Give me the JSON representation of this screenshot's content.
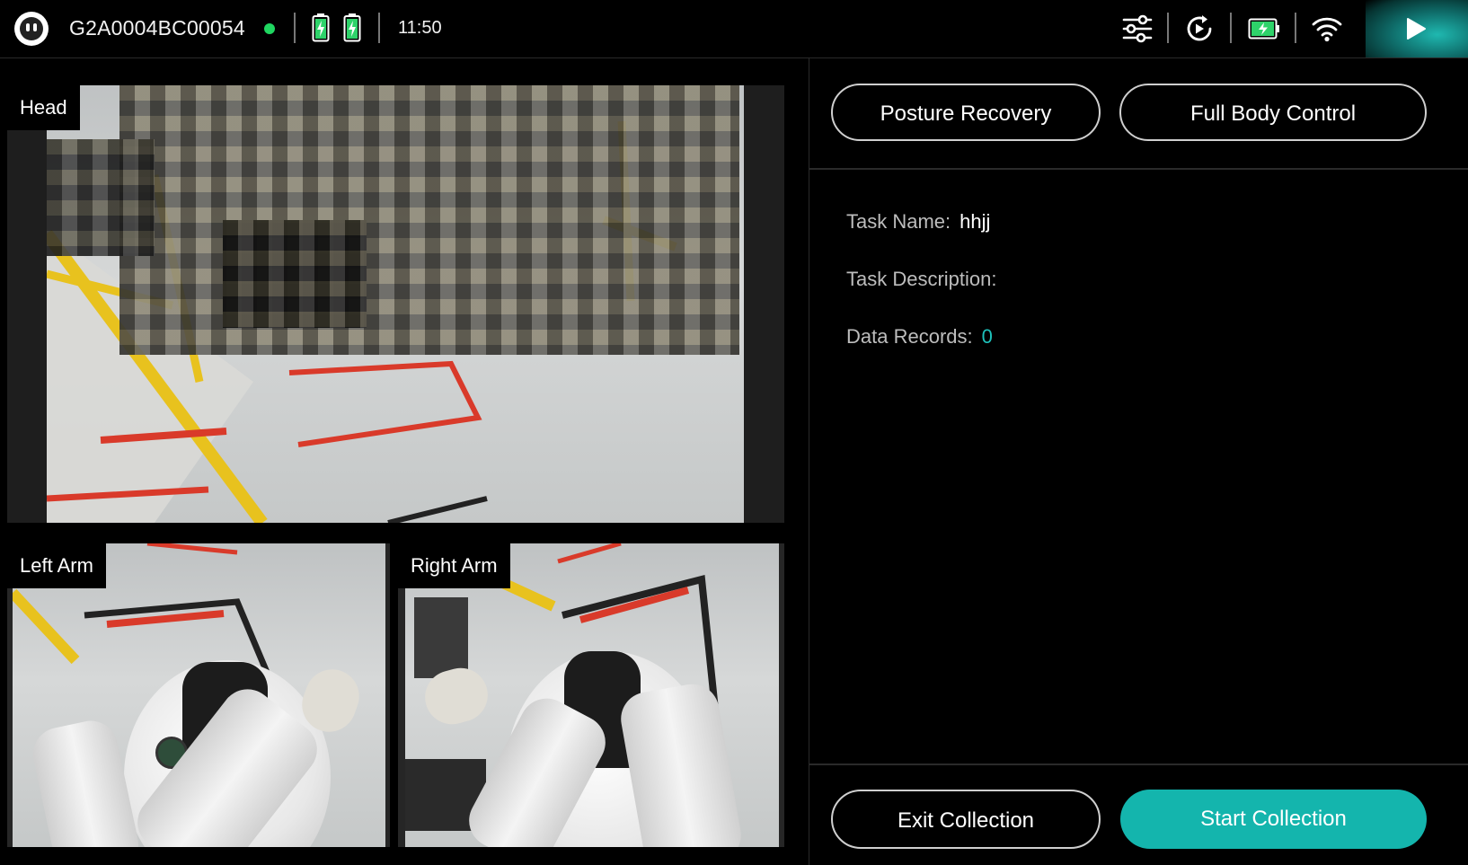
{
  "topbar": {
    "device_id": "G2A0004BC00054",
    "time": "11:50",
    "status_color": "#1fd660",
    "icons": [
      "robot-face-icon",
      "battery-icon",
      "battery-icon",
      "sliders-icon",
      "refresh-play-icon",
      "battery-horizontal-icon",
      "wifi-icon",
      "play-icon"
    ]
  },
  "cameras": {
    "head_label": "Head",
    "left_arm_label": "Left Arm",
    "right_arm_label": "Right Arm"
  },
  "actions": {
    "posture_recovery": "Posture Recovery",
    "full_body_control": "Full Body Control",
    "exit_collection": "Exit Collection",
    "start_collection": "Start Collection"
  },
  "task": {
    "name_label": "Task Name:",
    "name_value": "hhjj",
    "description_label": "Task Description:",
    "description_value": "",
    "records_label": "Data Records:",
    "records_value": "0"
  },
  "colors": {
    "accent": "#14b5ad",
    "records_value": "#1ec2bb",
    "battery": "#2ed36a"
  }
}
